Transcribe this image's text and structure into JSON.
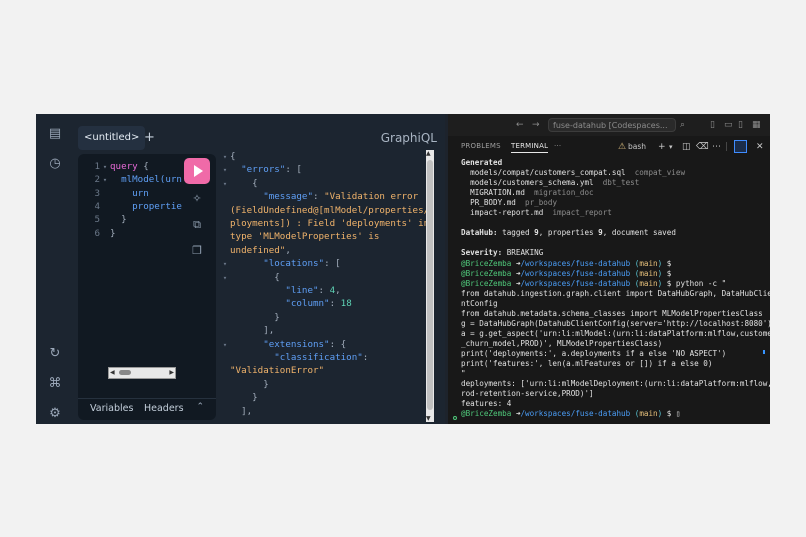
{
  "graphiql": {
    "tab_label": "<untitled>",
    "add_tab": "+",
    "logo": "GraphiQL",
    "query_lines": [
      {
        "num": "1",
        "fold": "▾",
        "tokens": [
          {
            "c": "kw",
            "t": "query"
          },
          {
            "c": "pu",
            "t": " {"
          }
        ]
      },
      {
        "num": "2",
        "fold": "▾",
        "tokens": [
          {
            "c": "fd",
            "t": "  mlModel(urn"
          }
        ]
      },
      {
        "num": "3",
        "fold": "",
        "tokens": [
          {
            "c": "fd",
            "t": "    urn"
          }
        ]
      },
      {
        "num": "4",
        "fold": "",
        "tokens": [
          {
            "c": "fd",
            "t": "    propertie"
          }
        ]
      },
      {
        "num": "5",
        "fold": "",
        "tokens": [
          {
            "c": "pu",
            "t": "  }"
          }
        ]
      },
      {
        "num": "6",
        "fold": "",
        "tokens": [
          {
            "c": "pu",
            "t": "}"
          }
        ]
      }
    ],
    "footer_variables": "Variables",
    "footer_headers": "Headers",
    "result_lines": [
      {
        "fold": "▾",
        "tokens": [
          {
            "c": "pu",
            "t": "{"
          }
        ]
      },
      {
        "fold": "▾",
        "tokens": [
          {
            "c": "pu",
            "t": "  "
          },
          {
            "c": "key",
            "t": "\"errors\""
          },
          {
            "c": "pu",
            "t": ": ["
          }
        ]
      },
      {
        "fold": "▾",
        "tokens": [
          {
            "c": "pu",
            "t": "    {"
          }
        ]
      },
      {
        "fold": "",
        "tokens": [
          {
            "c": "pu",
            "t": "      "
          },
          {
            "c": "key",
            "t": "\"message\""
          },
          {
            "c": "pu",
            "t": ": "
          },
          {
            "c": "str",
            "t": "\"Validation error"
          }
        ]
      },
      {
        "fold": "",
        "tokens": [
          {
            "c": "str",
            "t": "(FieldUndefined@[mlModel/properties/de"
          }
        ]
      },
      {
        "fold": "",
        "tokens": [
          {
            "c": "str",
            "t": "ployments]) : Field 'deployments' in"
          }
        ]
      },
      {
        "fold": "",
        "tokens": [
          {
            "c": "str",
            "t": "type 'MLModelProperties' is"
          }
        ]
      },
      {
        "fold": "",
        "tokens": [
          {
            "c": "str",
            "t": "undefined\""
          },
          {
            "c": "pu",
            "t": ","
          }
        ]
      },
      {
        "fold": "▾",
        "tokens": [
          {
            "c": "pu",
            "t": "      "
          },
          {
            "c": "key",
            "t": "\"locations\""
          },
          {
            "c": "pu",
            "t": ": ["
          }
        ]
      },
      {
        "fold": "▾",
        "tokens": [
          {
            "c": "pu",
            "t": "        {"
          }
        ]
      },
      {
        "fold": "",
        "tokens": [
          {
            "c": "pu",
            "t": "          "
          },
          {
            "c": "key",
            "t": "\"line\""
          },
          {
            "c": "pu",
            "t": ": "
          },
          {
            "c": "num",
            "t": "4"
          },
          {
            "c": "pu",
            "t": ","
          }
        ]
      },
      {
        "fold": "",
        "tokens": [
          {
            "c": "pu",
            "t": "          "
          },
          {
            "c": "key",
            "t": "\"column\""
          },
          {
            "c": "pu",
            "t": ": "
          },
          {
            "c": "num",
            "t": "18"
          }
        ]
      },
      {
        "fold": "",
        "tokens": [
          {
            "c": "pu",
            "t": "        }"
          }
        ]
      },
      {
        "fold": "",
        "tokens": [
          {
            "c": "pu",
            "t": "      ],"
          }
        ]
      },
      {
        "fold": "▾",
        "tokens": [
          {
            "c": "pu",
            "t": "      "
          },
          {
            "c": "key",
            "t": "\"extensions\""
          },
          {
            "c": "pu",
            "t": ": {"
          }
        ]
      },
      {
        "fold": "",
        "tokens": [
          {
            "c": "pu",
            "t": "        "
          },
          {
            "c": "key",
            "t": "\"classification\""
          },
          {
            "c": "pu",
            "t": ":"
          }
        ]
      },
      {
        "fold": "",
        "tokens": [
          {
            "c": "str",
            "t": "\"ValidationError\""
          }
        ]
      },
      {
        "fold": "",
        "tokens": [
          {
            "c": "pu",
            "t": "      }"
          }
        ]
      },
      {
        "fold": "",
        "tokens": [
          {
            "c": "pu",
            "t": "    }"
          }
        ]
      },
      {
        "fold": "",
        "tokens": [
          {
            "c": "pu",
            "t": "  ],"
          }
        ]
      }
    ]
  },
  "vscode": {
    "command_center": "fuse-datahub [Codespaces...",
    "tab_problems": "PROBLEMS",
    "tab_terminal": "TERMINAL",
    "tab_more": "···",
    "terminal_shell": "bash",
    "terminal_lines": [
      [
        {
          "c": "b",
          "t": "Generated"
        }
      ],
      [
        {
          "c": "",
          "t": "  models/compat/customers_compat.sql  "
        },
        {
          "c": "dim",
          "t": "compat_view"
        }
      ],
      [
        {
          "c": "",
          "t": "  models/customers_schema.yml  "
        },
        {
          "c": "dim",
          "t": "dbt_test"
        }
      ],
      [
        {
          "c": "",
          "t": "  MIGRATION.md  "
        },
        {
          "c": "dim",
          "t": "migration_doc"
        }
      ],
      [
        {
          "c": "",
          "t": "  PR_BODY.md  "
        },
        {
          "c": "dim",
          "t": "pr_body"
        }
      ],
      [
        {
          "c": "",
          "t": "  impact-report.md  "
        },
        {
          "c": "dim",
          "t": "impact_report"
        }
      ],
      [
        {
          "c": "",
          "t": ""
        }
      ],
      [
        {
          "c": "b",
          "t": "DataHub:"
        },
        {
          "c": "",
          "t": " tagged "
        },
        {
          "c": "b",
          "t": "9"
        },
        {
          "c": "",
          "t": ", properties "
        },
        {
          "c": "b",
          "t": "9"
        },
        {
          "c": "",
          "t": ", document saved"
        }
      ],
      [
        {
          "c": "",
          "t": ""
        }
      ],
      [
        {
          "c": "b",
          "t": "Severity:"
        },
        {
          "c": "",
          "t": " BREAKING"
        }
      ],
      [
        {
          "c": "gr",
          "t": "@BriceZemba "
        },
        {
          "c": "",
          "t": "➜"
        },
        {
          "c": "bl",
          "t": "/workspaces/fuse-datahub"
        },
        {
          "c": "cy",
          "t": " ("
        },
        {
          "c": "yl",
          "t": "main"
        },
        {
          "c": "cy",
          "t": ")"
        },
        {
          "c": "",
          "t": " $"
        }
      ],
      [
        {
          "c": "gr",
          "t": "@BriceZemba "
        },
        {
          "c": "",
          "t": "➜"
        },
        {
          "c": "bl",
          "t": "/workspaces/fuse-datahub"
        },
        {
          "c": "cy",
          "t": " ("
        },
        {
          "c": "yl",
          "t": "main"
        },
        {
          "c": "cy",
          "t": ")"
        },
        {
          "c": "",
          "t": " $"
        }
      ],
      [
        {
          "c": "gr",
          "t": "@BriceZemba "
        },
        {
          "c": "",
          "t": "➜"
        },
        {
          "c": "bl",
          "t": "/workspaces/fuse-datahub"
        },
        {
          "c": "cy",
          "t": " ("
        },
        {
          "c": "yl",
          "t": "main"
        },
        {
          "c": "cy",
          "t": ")"
        },
        {
          "c": "",
          "t": " $ python -c \""
        }
      ],
      [
        {
          "c": "",
          "t": "from datahub.ingestion.graph.client import DataHubGraph, DataHubClie"
        }
      ],
      [
        {
          "c": "",
          "t": "ntConfig"
        }
      ],
      [
        {
          "c": "",
          "t": "from datahub.metadata.schema_classes import MLModelPropertiesClass"
        }
      ],
      [
        {
          "c": "",
          "t": "g = DataHubGraph(DatahubClientConfig(server='http://localhost:8080'))"
        }
      ],
      [
        {
          "c": "",
          "t": "a = g.get_aspect('urn:li:mlModel:(urn:li:dataPlatform:mlflow,customer"
        }
      ],
      [
        {
          "c": "",
          "t": "_churn_model,PROD)', MLModelPropertiesClass)"
        }
      ],
      [
        {
          "c": "",
          "t": "print('deployments:', a.deployments if a else 'NO ASPECT')"
        }
      ],
      [
        {
          "c": "",
          "t": "print('features:', len(a.mlFeatures or []) if a else 0)"
        }
      ],
      [
        {
          "c": "",
          "t": "\""
        }
      ],
      [
        {
          "c": "",
          "t": "deployments: ['urn:li:mlModelDeployment:(urn:li:dataPlatform:mlflow,p"
        }
      ],
      [
        {
          "c": "",
          "t": "rod-retention-service,PROD)']"
        }
      ],
      [
        {
          "c": "",
          "t": "features: 4"
        }
      ],
      [
        {
          "c": "gr",
          "t": "@BriceZemba "
        },
        {
          "c": "",
          "t": "➜"
        },
        {
          "c": "bl",
          "t": "/workspaces/fuse-datahub"
        },
        {
          "c": "cy",
          "t": " ("
        },
        {
          "c": "yl",
          "t": "main"
        },
        {
          "c": "cy",
          "t": ")"
        },
        {
          "c": "",
          "t": " $ ▯"
        }
      ]
    ]
  }
}
